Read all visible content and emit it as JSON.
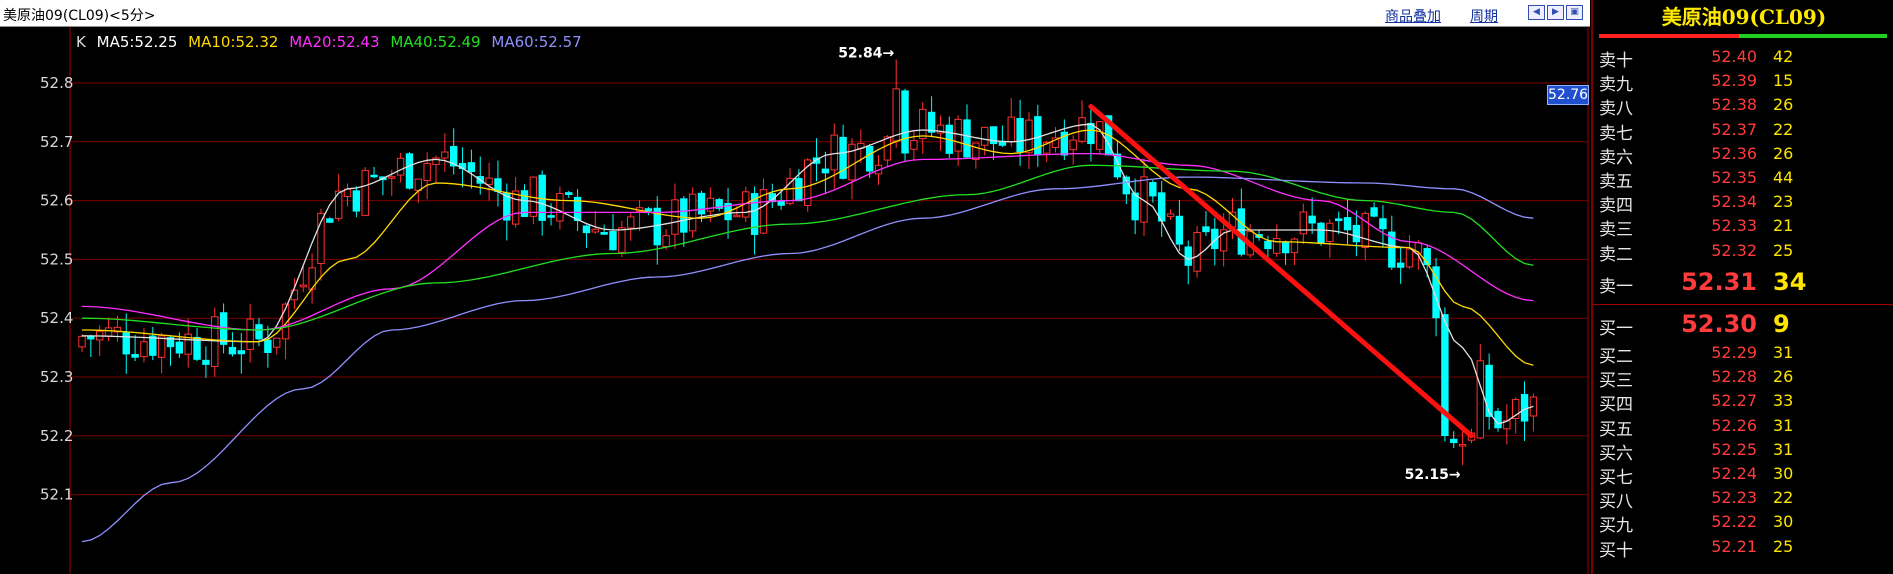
{
  "header": {
    "title": "美原油09(CL09)<5分>",
    "links": [
      "商品叠加",
      "周期"
    ],
    "nav_icons": [
      "zoom-out-icon",
      "zoom-in-icon",
      "fullscreen-icon"
    ]
  },
  "legend": {
    "prefix": "K",
    "items": [
      {
        "text": "MA5:52.25",
        "color": "#ffffff"
      },
      {
        "text": "MA10:52.32",
        "color": "#ffd800"
      },
      {
        "text": "MA20:52.43",
        "color": "#ff30ff"
      },
      {
        "text": "MA40:52.49",
        "color": "#20e020"
      },
      {
        "text": "MA60:52.57",
        "color": "#9090ff"
      }
    ]
  },
  "price_tag": "52.76",
  "chart_data": {
    "type": "candlestick",
    "title": "",
    "xlabel": "",
    "ylabel": "",
    "ylim": [
      52.0,
      52.88
    ],
    "y_ticks": [
      "52.8",
      "52.7",
      "52.6",
      "52.5",
      "52.4",
      "52.3",
      "52.2",
      "52.1"
    ],
    "annotations": [
      {
        "text": "52.84→",
        "price": 52.84,
        "bar_index": 92
      },
      {
        "text": "52.15→",
        "price": 52.15,
        "bar_index": 156
      }
    ],
    "trendline": {
      "from": {
        "bar_index": 114,
        "price": 52.76
      },
      "to": {
        "bar_index": 157,
        "price": 52.2
      },
      "color": "#ff1010"
    },
    "series": [
      {
        "name": "MA5",
        "color": "#e0e0e0",
        "anchors": [
          [
            0,
            52.37
          ],
          [
            20,
            52.36
          ],
          [
            30,
            52.62
          ],
          [
            40,
            52.67
          ],
          [
            50,
            52.6
          ],
          [
            60,
            52.55
          ],
          [
            75,
            52.58
          ],
          [
            85,
            52.68
          ],
          [
            95,
            52.72
          ],
          [
            105,
            52.7
          ],
          [
            114,
            52.73
          ],
          [
            120,
            52.6
          ],
          [
            125,
            52.5
          ],
          [
            130,
            52.55
          ],
          [
            140,
            52.55
          ],
          [
            150,
            52.52
          ],
          [
            156,
            52.35
          ],
          [
            160,
            52.22
          ],
          [
            164,
            52.25
          ]
        ]
      },
      {
        "name": "MA10",
        "color": "#ffd800",
        "anchors": [
          [
            0,
            52.38
          ],
          [
            20,
            52.36
          ],
          [
            30,
            52.5
          ],
          [
            40,
            52.63
          ],
          [
            55,
            52.6
          ],
          [
            70,
            52.57
          ],
          [
            80,
            52.62
          ],
          [
            95,
            52.71
          ],
          [
            105,
            52.68
          ],
          [
            114,
            52.72
          ],
          [
            125,
            52.62
          ],
          [
            135,
            52.53
          ],
          [
            150,
            52.52
          ],
          [
            156,
            52.42
          ],
          [
            164,
            52.32
          ]
        ]
      },
      {
        "name": "MA20",
        "color": "#ff30ff",
        "anchors": [
          [
            0,
            52.42
          ],
          [
            20,
            52.38
          ],
          [
            35,
            52.45
          ],
          [
            50,
            52.58
          ],
          [
            65,
            52.58
          ],
          [
            80,
            52.6
          ],
          [
            95,
            52.67
          ],
          [
            114,
            52.68
          ],
          [
            125,
            52.66
          ],
          [
            140,
            52.6
          ],
          [
            150,
            52.53
          ],
          [
            164,
            52.43
          ]
        ]
      },
      {
        "name": "MA40",
        "color": "#20e020",
        "anchors": [
          [
            0,
            52.4
          ],
          [
            20,
            52.38
          ],
          [
            40,
            52.46
          ],
          [
            60,
            52.51
          ],
          [
            80,
            52.56
          ],
          [
            100,
            52.61
          ],
          [
            114,
            52.66
          ],
          [
            130,
            52.65
          ],
          [
            145,
            52.6
          ],
          [
            155,
            52.58
          ],
          [
            164,
            52.49
          ]
        ]
      },
      {
        "name": "MA60",
        "color": "#9090ff",
        "anchors": [
          [
            0,
            52.02
          ],
          [
            10,
            52.12
          ],
          [
            25,
            52.28
          ],
          [
            35,
            52.38
          ],
          [
            50,
            52.43
          ],
          [
            65,
            52.47
          ],
          [
            80,
            52.51
          ],
          [
            95,
            52.57
          ],
          [
            110,
            52.62
          ],
          [
            125,
            52.64
          ],
          [
            145,
            52.63
          ],
          [
            155,
            52.62
          ],
          [
            164,
            52.57
          ]
        ]
      }
    ]
  },
  "quote_panel": {
    "title": "美原油09(CL09)",
    "asks": [
      {
        "label": "卖十",
        "price": "52.40",
        "vol": "42"
      },
      {
        "label": "卖九",
        "price": "52.39",
        "vol": "15"
      },
      {
        "label": "卖八",
        "price": "52.38",
        "vol": "26"
      },
      {
        "label": "卖七",
        "price": "52.37",
        "vol": "22"
      },
      {
        "label": "卖六",
        "price": "52.36",
        "vol": "26"
      },
      {
        "label": "卖五",
        "price": "52.35",
        "vol": "44"
      },
      {
        "label": "卖四",
        "price": "52.34",
        "vol": "23"
      },
      {
        "label": "卖三",
        "price": "52.33",
        "vol": "21"
      },
      {
        "label": "卖二",
        "price": "52.32",
        "vol": "25"
      },
      {
        "label": "卖一",
        "price": "52.31",
        "vol": "34"
      }
    ],
    "bids": [
      {
        "label": "买一",
        "price": "52.30",
        "vol": "9"
      },
      {
        "label": "买二",
        "price": "52.29",
        "vol": "31"
      },
      {
        "label": "买三",
        "price": "52.28",
        "vol": "26"
      },
      {
        "label": "买四",
        "price": "52.27",
        "vol": "33"
      },
      {
        "label": "买五",
        "price": "52.26",
        "vol": "31"
      },
      {
        "label": "买六",
        "price": "52.25",
        "vol": "31"
      },
      {
        "label": "买七",
        "price": "52.24",
        "vol": "30"
      },
      {
        "label": "买八",
        "price": "52.23",
        "vol": "22"
      },
      {
        "label": "买九",
        "price": "52.22",
        "vol": "30"
      },
      {
        "label": "买十",
        "price": "52.21",
        "vol": "25"
      }
    ]
  }
}
